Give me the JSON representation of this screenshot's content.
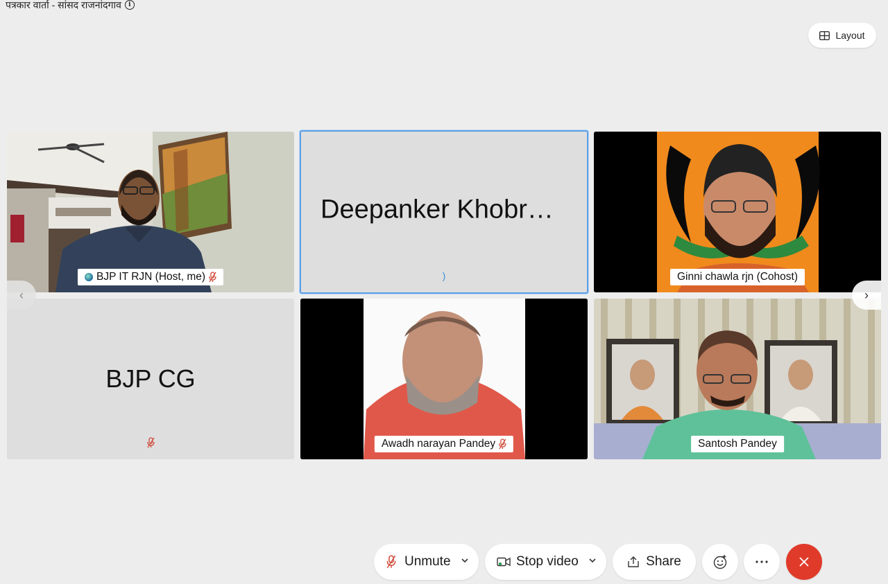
{
  "meeting": {
    "title": "पत्रकार वार्ता - सांसद राजनांदगाव"
  },
  "layout_button": {
    "label": "Layout"
  },
  "tiles": [
    {
      "name": "BJP IT RJN (Host, me)",
      "kind": "video"
    },
    {
      "name": "Deepanker Khobrag…",
      "kind": "avatar",
      "status_glyph": ")"
    },
    {
      "name": "Ginni chawla rjn (Cohost)",
      "kind": "video"
    },
    {
      "name": "BJP CG",
      "kind": "avatar"
    },
    {
      "name": "Awadh narayan Pandey",
      "kind": "video"
    },
    {
      "name": "Santosh Pandey",
      "kind": "video"
    }
  ],
  "toolbar": {
    "unmute_label": "Unmute",
    "stop_video_label": "Stop video",
    "share_label": "Share"
  },
  "colors": {
    "accent": "#5b9fe6",
    "end": "#e03a2b",
    "mic_off": "#d04a3a",
    "bjp_orange": "#f08a1d"
  }
}
